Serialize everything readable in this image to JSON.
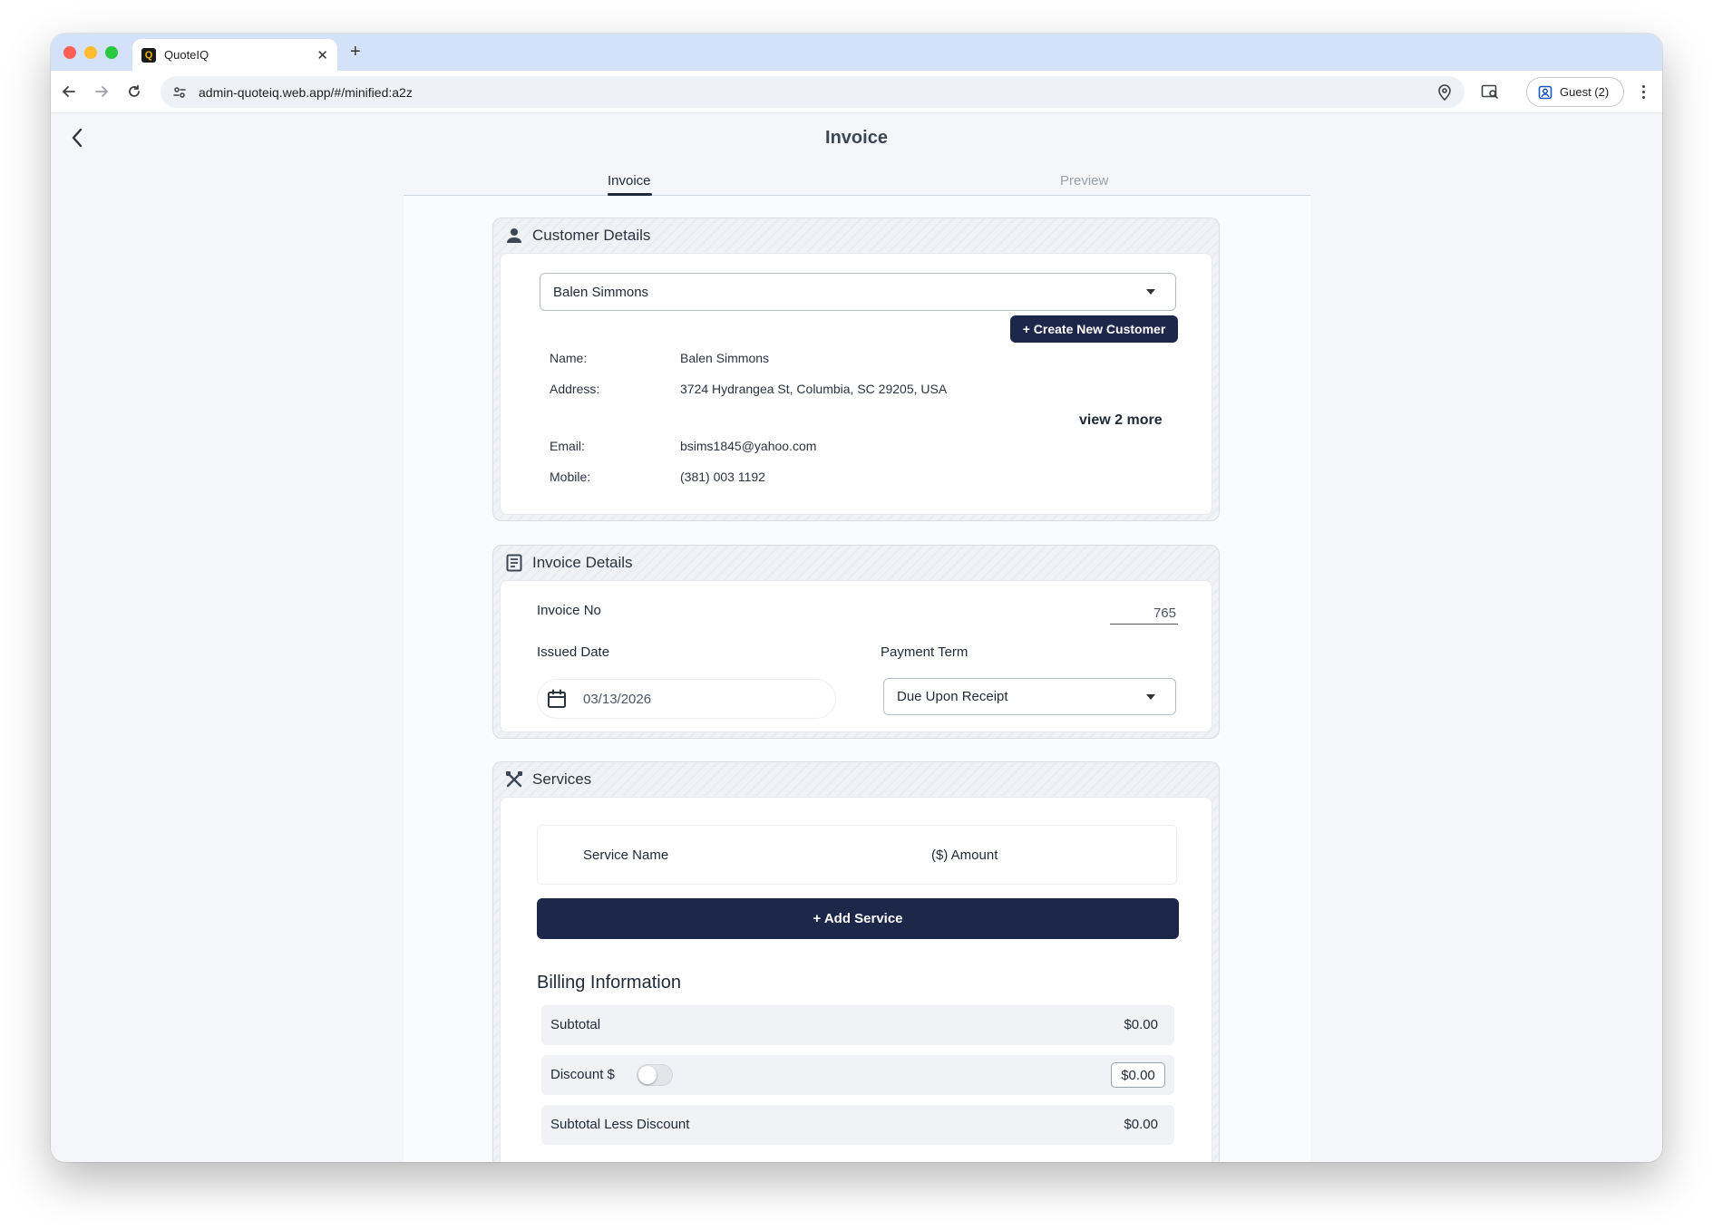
{
  "browser": {
    "tab_title": "QuoteIQ",
    "url": "admin-quoteiq.web.app/#/minified:a2z",
    "profile_label": "Guest (2)"
  },
  "page": {
    "title": "Invoice",
    "tabs": [
      {
        "label": "Invoice",
        "active": true
      },
      {
        "label": "Preview",
        "active": false
      }
    ]
  },
  "customer": {
    "section_title": "Customer Details",
    "selected_customer": "Balen Simmons",
    "create_button": "+ Create New Customer",
    "fields": [
      {
        "label": "Name:",
        "value": "Balen Simmons"
      },
      {
        "label": "Address:",
        "value": "3724 Hydrangea St, Columbia, SC 29205, USA"
      },
      {
        "label": "Email:",
        "value": "bsims1845@yahoo.com"
      },
      {
        "label": "Mobile:",
        "value": "(381) 003 1192"
      }
    ],
    "view_more": "view 2 more"
  },
  "invoice": {
    "section_title": "Invoice Details",
    "invoice_no_label": "Invoice No",
    "invoice_no": "765",
    "issued_date_label": "Issued Date",
    "issued_date": "03/13/2026",
    "payment_term_label": "Payment Term",
    "payment_term": "Due Upon Receipt"
  },
  "services": {
    "section_title": "Services",
    "columns": [
      "Service Name",
      "($) Amount"
    ],
    "add_button": "+ Add Service"
  },
  "billing": {
    "title": "Billing Information",
    "subtotal_label": "Subtotal",
    "subtotal": "$0.00",
    "discount_label": "Discount $",
    "discount_enabled": false,
    "discount_value": "$0.00",
    "subtotal_less_label": "Subtotal Less Discount",
    "subtotal_less": "$0.00"
  },
  "colors": {
    "accent": "#1d274a",
    "tab_bar": "#d3e1f9",
    "page_bg": "#f4f6fa"
  }
}
